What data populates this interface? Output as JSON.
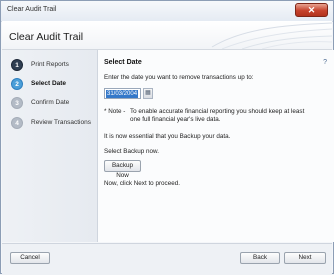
{
  "window": {
    "title": "Clear Audit Trail"
  },
  "header": {
    "title": "Clear Audit Trail"
  },
  "steps": [
    {
      "num": "1",
      "label": "Print Reports",
      "state": "done"
    },
    {
      "num": "2",
      "label": "Select Date",
      "state": "active"
    },
    {
      "num": "3",
      "label": "Confirm Date",
      "state": "pending"
    },
    {
      "num": "4",
      "label": "Review Transactions",
      "state": "pending"
    }
  ],
  "content": {
    "title": "Select Date",
    "help": "?",
    "prompt": "Enter the date you want to remove transactions up to:",
    "date_value": "31/03/2004",
    "note_label": "* Note -",
    "note_line1": "To enable accurate financial reporting you should keep at least",
    "note_line2": "one full financial year's live data.",
    "backup_essential": "It is now essential that you Backup your data.",
    "select_backup": "Select Backup now.",
    "backup_button": "Backup Now",
    "next_instruction": "Now, click Next to proceed."
  },
  "footer": {
    "cancel": "Cancel",
    "back": "Back",
    "next": "Next"
  },
  "colors": {
    "active_step": "#4a9ed8",
    "done_step": "#2f3e52",
    "pending_step": "#b3bbc6",
    "close_button": "#c6422c"
  },
  "icons": {
    "calendar": "calendar-icon",
    "close": "close-icon",
    "help": "help-icon"
  }
}
